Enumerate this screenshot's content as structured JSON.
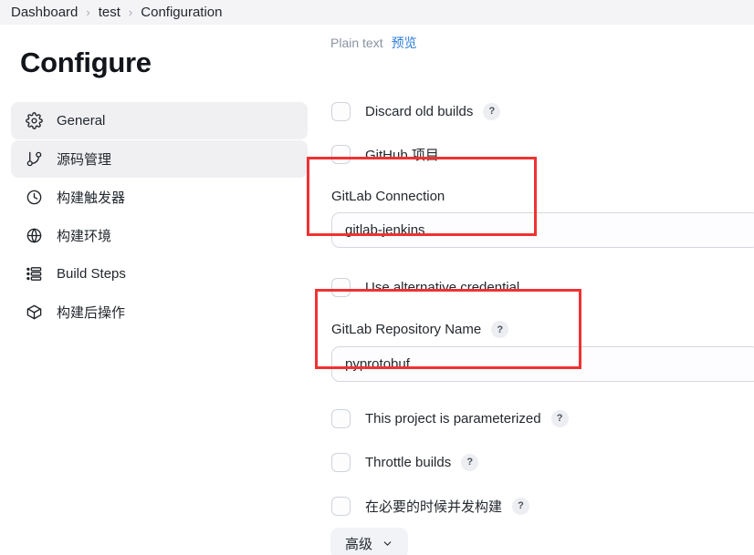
{
  "breadcrumb": {
    "items": [
      {
        "label": "Dashboard"
      },
      {
        "label": "test"
      },
      {
        "label": "Configuration"
      }
    ],
    "separator": "›"
  },
  "sidebar": {
    "title": "Configure",
    "items": [
      {
        "label": "General",
        "icon": "gear-icon",
        "active": true
      },
      {
        "label": "源码管理",
        "icon": "git-branch-icon",
        "active": true
      },
      {
        "label": "构建触发器",
        "icon": "clock-icon",
        "active": false
      },
      {
        "label": "构建环境",
        "icon": "globe-icon",
        "active": false
      },
      {
        "label": "Build Steps",
        "icon": "list-icon",
        "active": false
      },
      {
        "label": "构建后操作",
        "icon": "package-icon",
        "active": false
      }
    ]
  },
  "main": {
    "plain_text_label": "Plain text",
    "preview_link": "预览",
    "help_badge": "?",
    "checkboxes": [
      {
        "label": "Discard old builds",
        "checked": false,
        "help": true
      },
      {
        "label": "GitHub 项目",
        "checked": false,
        "help": false
      },
      {
        "label": "Use alternative credential",
        "checked": false,
        "help": false
      },
      {
        "label": "This project is parameterized",
        "checked": false,
        "help": true
      },
      {
        "label": "Throttle builds",
        "checked": false,
        "help": true
      },
      {
        "label": "在必要的时候并发构建",
        "checked": false,
        "help": true
      }
    ],
    "gitlab_connection": {
      "label": "GitLab Connection",
      "value": "gitlab-jenkins",
      "placeholder": ""
    },
    "gitlab_repository_name": {
      "label": "GitLab Repository Name",
      "value": "pyprotobuf",
      "placeholder": "",
      "help": "?"
    },
    "advanced_button": "高级"
  },
  "colors": {
    "annotation": "#f03232",
    "link": "#2b7ddb",
    "muted_text": "#8b93a1",
    "header_bg": "#f4f4f7",
    "active_nav_bg": "#f0f0f3"
  }
}
